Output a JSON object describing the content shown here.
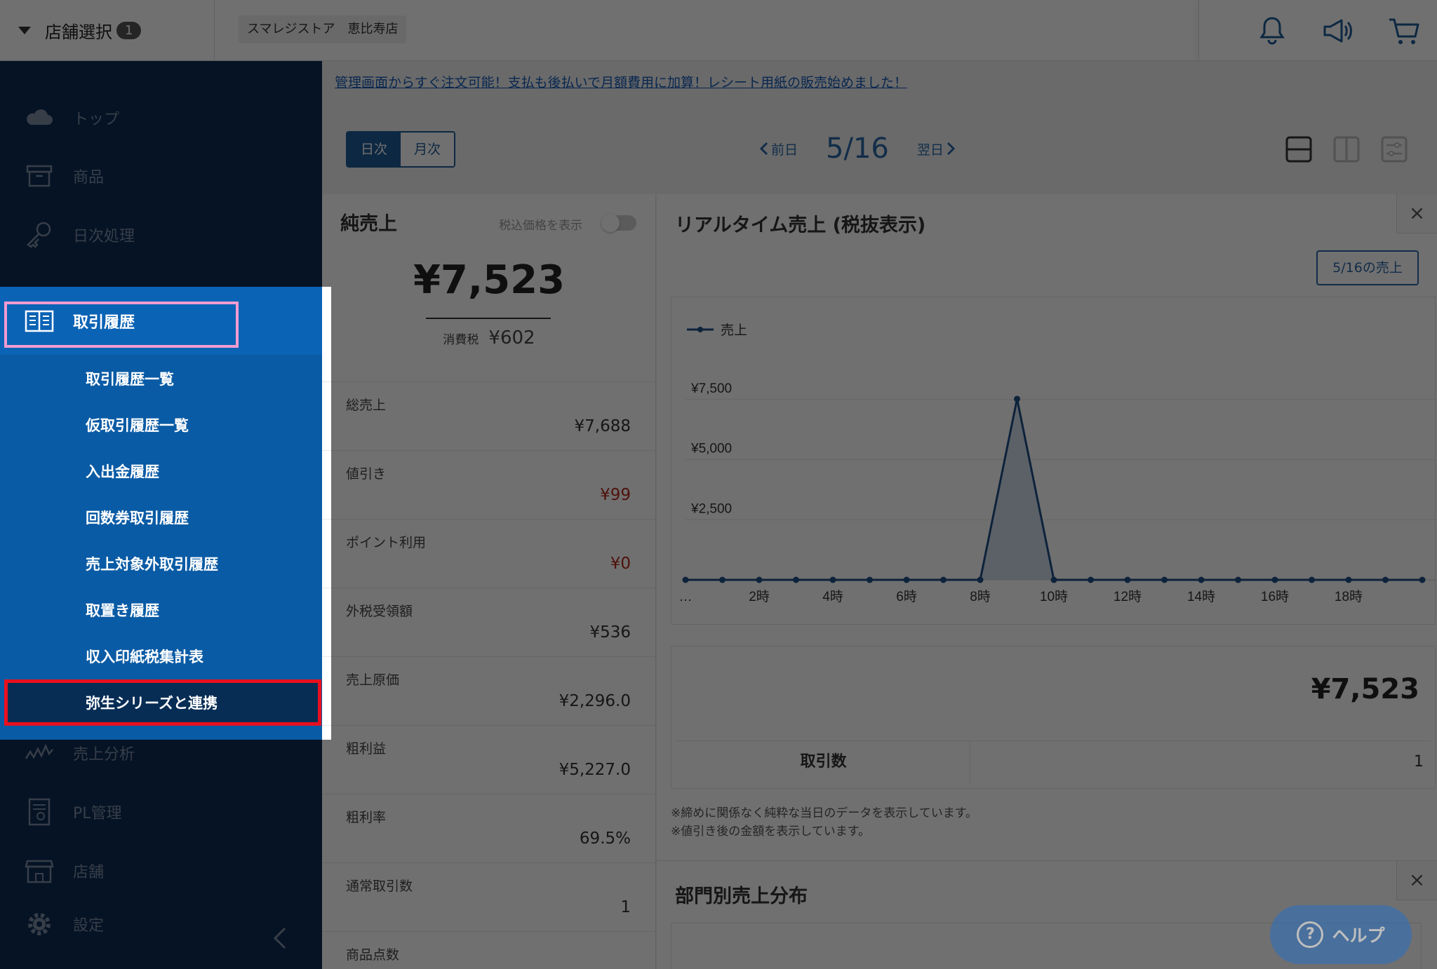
{
  "topbar": {
    "store_select_label": "店舗選択",
    "store_count": "1",
    "store_name": "スマレジストア　恵比寿店",
    "icons": [
      "bell-icon",
      "megaphone-icon",
      "cart-icon"
    ]
  },
  "sidebar": {
    "items_top": [
      {
        "label": "トップ",
        "icon": "cloud-icon"
      },
      {
        "label": "商品",
        "icon": "box-icon"
      },
      {
        "label": "日次処理",
        "icon": "key-icon"
      }
    ],
    "active": {
      "label": "取引履歴",
      "icon": "book-icon"
    },
    "sub_items": [
      "取引履歴一覧",
      "仮取引履歴一覧",
      "入出金履歴",
      "回数券取引履歴",
      "売上対象外取引履歴",
      "取置き履歴",
      "収入印紙税集計表",
      "弥生シリーズと連携"
    ],
    "items_bottom": [
      {
        "label": "売上分析",
        "icon": "line-chart-icon"
      },
      {
        "label": "PL管理",
        "icon": "report-icon"
      },
      {
        "label": "店舗",
        "icon": "store-icon"
      },
      {
        "label": "設定",
        "icon": "gear-icon"
      }
    ]
  },
  "main": {
    "notice": "管理画面からすぐ注文可能！支払も後払いで月額費用に加算！レシート用紙の販売始めました！",
    "view_tabs": {
      "daily": "日次",
      "monthly": "月次"
    },
    "date_nav": {
      "prev": "前日",
      "date": "5/16",
      "next": "翌日"
    },
    "summary": {
      "title": "純売上",
      "toggle_label": "税込価格を表示",
      "net_sales": "¥7,523",
      "tax_label": "消費税",
      "tax_value": "¥602",
      "rows": [
        {
          "label": "総売上",
          "value": "¥7,688"
        },
        {
          "label": "値引き",
          "value": "¥99"
        },
        {
          "label": "ポイント利用",
          "value": "¥0"
        },
        {
          "label": "外税受領額",
          "value": "¥536"
        },
        {
          "label": "売上原価",
          "value": "¥2,296.0"
        },
        {
          "label": "粗利益",
          "value": "¥5,227.0"
        },
        {
          "label": "粗利率",
          "value": "69.5%"
        },
        {
          "label": "通常取引数",
          "value": "1"
        },
        {
          "label": "商品点数",
          "value": ""
        }
      ]
    },
    "realtime": {
      "title": "リアルタイム売上 (税抜表示)",
      "close": "×",
      "day_button": "5/16の売上",
      "total": "¥7,523",
      "txn_label": "取引数",
      "txn_value": "1",
      "notes": [
        "※締めに関係なく純粋な当日のデータを表示しています。",
        "※値引き後の金額を表示しています。"
      ]
    },
    "dept": {
      "title": "部門別売上分布",
      "close": "×"
    },
    "help_label": "ヘルプ"
  },
  "chart_data": {
    "type": "area",
    "legend": [
      "売上"
    ],
    "legend_position": "top-left",
    "x_tick_labels": [
      "…",
      "2時",
      "4時",
      "6時",
      "8時",
      "10時",
      "12時",
      "14時",
      "16時",
      "18時"
    ],
    "y_tick_labels": [
      "¥2,500",
      "¥5,000",
      "¥7,500"
    ],
    "ylim": [
      0,
      10000
    ],
    "series": [
      {
        "name": "売上",
        "x": [
          0,
          1,
          2,
          3,
          4,
          5,
          6,
          7,
          8,
          9,
          10,
          11,
          12,
          13,
          14,
          15,
          16,
          17,
          18,
          19,
          20
        ],
        "values": [
          0,
          0,
          0,
          0,
          0,
          0,
          0,
          0,
          0,
          7523,
          0,
          0,
          0,
          0,
          0,
          0,
          0,
          0,
          0,
          0,
          0
        ]
      }
    ],
    "grid": true,
    "colors": {
      "line": "#1e4f86",
      "fill": "#c9d7e6"
    }
  }
}
